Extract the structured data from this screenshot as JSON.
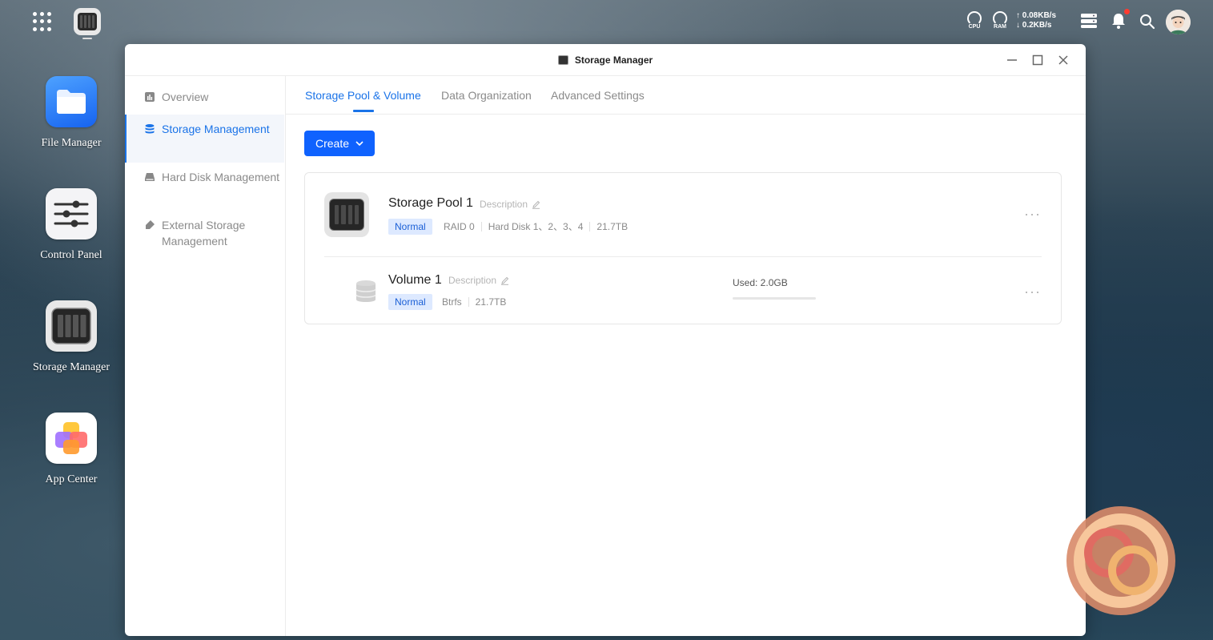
{
  "topbar": {
    "cpu_label": "CPU",
    "ram_label": "RAM",
    "upload": "↑ 0.08KB/s",
    "download": "↓ 0.2KB/s"
  },
  "desktop": {
    "icons": [
      {
        "label": "File Manager"
      },
      {
        "label": "Control Panel"
      },
      {
        "label": "Storage Manager"
      },
      {
        "label": "App Center"
      }
    ]
  },
  "window": {
    "title": "Storage Manager"
  },
  "sidebar": {
    "items": [
      {
        "label": "Overview",
        "icon": "chart-icon"
      },
      {
        "label": "Storage Management",
        "icon": "database-icon"
      },
      {
        "label": "Hard Disk Management",
        "icon": "hard-disk-icon"
      },
      {
        "label": "External Storage Management",
        "icon": "usb-icon"
      }
    ],
    "active_index": 1
  },
  "tabs": [
    {
      "label": "Storage Pool & Volume"
    },
    {
      "label": "Data Organization"
    },
    {
      "label": "Advanced Settings"
    }
  ],
  "create_button": {
    "label": "Create"
  },
  "pool": {
    "name": "Storage Pool 1",
    "description_placeholder": "Description",
    "status": "Normal",
    "raid": "RAID 0",
    "disks": "Hard Disk 1、2、3、4",
    "capacity": "21.7TB"
  },
  "volume": {
    "name": "Volume 1",
    "description_placeholder": "Description",
    "status": "Normal",
    "filesystem": "Btrfs",
    "capacity": "21.7TB",
    "used_label": "Used: 2.0GB",
    "used_fraction": 0.0001
  },
  "colors": {
    "accent": "#1a73e8",
    "primary_button": "#0f62fe",
    "badge_bg": "#dde9ff"
  }
}
